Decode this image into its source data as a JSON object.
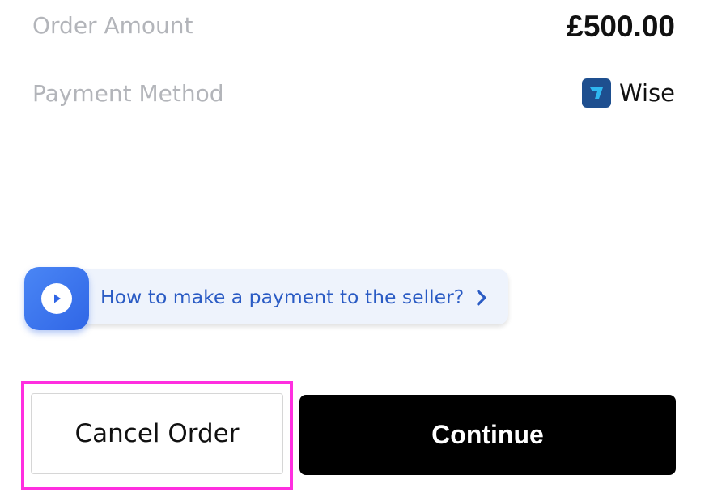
{
  "order": {
    "amount_label": "Order Amount",
    "amount_value": "£500.00",
    "payment_method_label": "Payment Method",
    "payment_method_value": "Wise",
    "payment_method_icon": "wise-logo-icon"
  },
  "help": {
    "text": "How to make a payment to the seller?",
    "icon": "play-icon",
    "chevron_icon": "chevron-right-icon"
  },
  "actions": {
    "cancel_label": "Cancel Order",
    "continue_label": "Continue"
  },
  "colors": {
    "label_gray": "#b3b5ba",
    "help_blue": "#2a5bc4",
    "continue_bg": "#000000",
    "highlight": "#ff2fe0",
    "wise_brand": "#1e4f8f"
  }
}
